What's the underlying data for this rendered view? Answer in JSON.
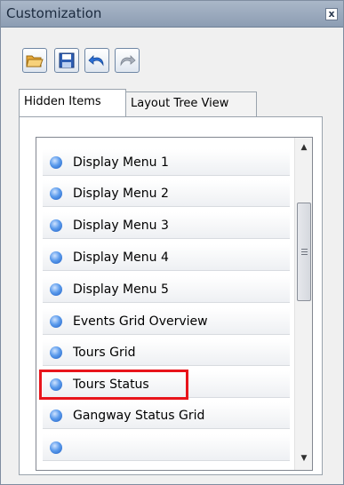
{
  "window": {
    "title": "Customization",
    "close_label": "x"
  },
  "toolbar": {
    "buttons": [
      {
        "name": "open",
        "icon": "folder-open-icon"
      },
      {
        "name": "save",
        "icon": "floppy-disk-icon"
      },
      {
        "name": "undo",
        "icon": "undo-arrow-icon"
      },
      {
        "name": "redo",
        "icon": "redo-arrow-icon",
        "disabled": true
      }
    ]
  },
  "tabs": [
    {
      "label": "Hidden Items",
      "active": true
    },
    {
      "label": "Layout Tree View",
      "active": false
    }
  ],
  "list": {
    "items": [
      {
        "label": "Display Menu 1"
      },
      {
        "label": "Display Menu 2"
      },
      {
        "label": "Display Menu 3"
      },
      {
        "label": "Display Menu 4"
      },
      {
        "label": "Display Menu 5"
      },
      {
        "label": "Events Grid Overview"
      },
      {
        "label": "Tours Grid"
      },
      {
        "label": "Tours Status",
        "highlighted": true
      },
      {
        "label": "Gangway Status Grid"
      }
    ]
  },
  "colors": {
    "highlight": "#e8141b",
    "bullet": "#3f84e0",
    "titlebar": "#9aaabf"
  }
}
